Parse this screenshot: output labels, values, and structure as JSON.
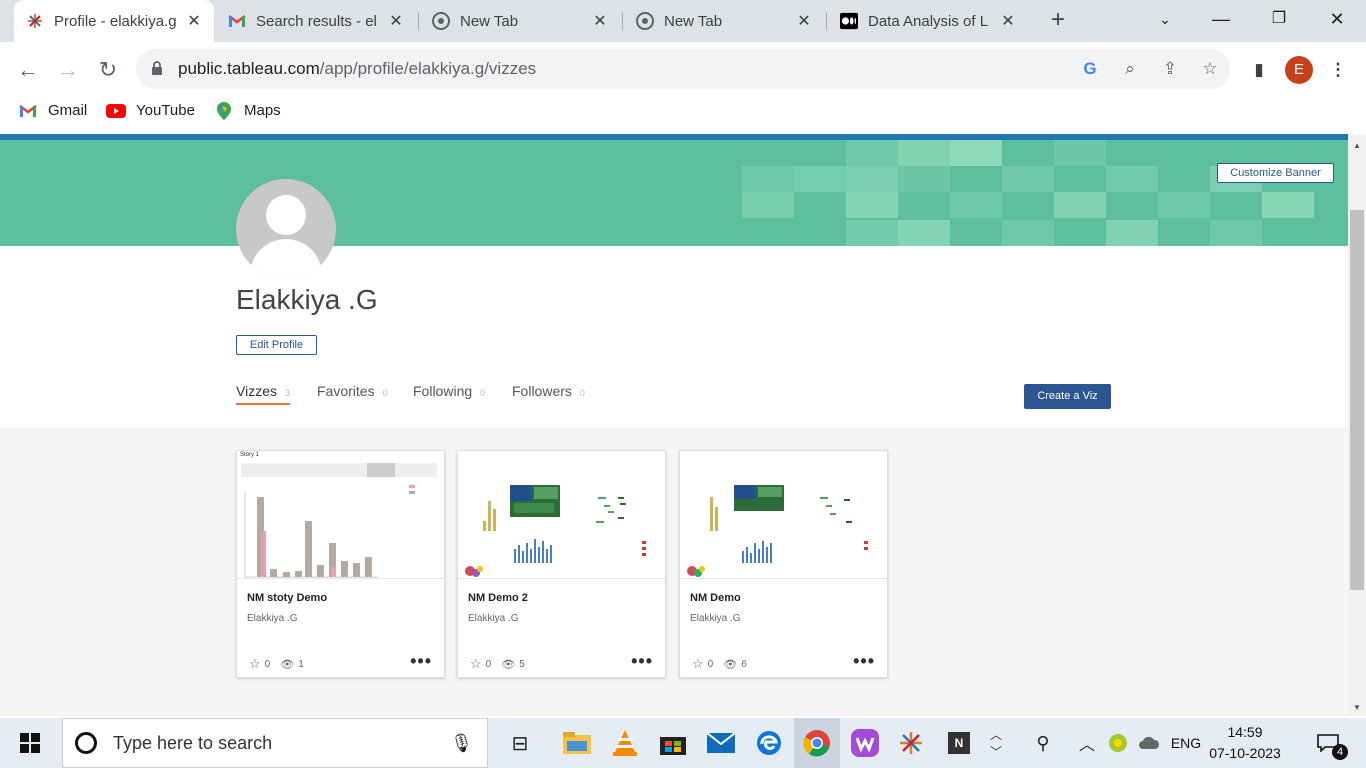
{
  "browser": {
    "tabs": [
      {
        "title": "Profile - elakkiya.g",
        "icon": "tableau-icon",
        "active": true
      },
      {
        "title": "Search results - el",
        "icon": "gmail-icon",
        "active": false
      },
      {
        "title": "New Tab",
        "icon": "chrome-icon",
        "active": false
      },
      {
        "title": "New Tab",
        "icon": "chrome-icon",
        "active": false
      },
      {
        "title": "Data Analysis of L",
        "icon": "medium-icon",
        "active": false
      }
    ],
    "url_domain": "public.tableau.com",
    "url_path": "/app/profile/elakkiya.g/vizzes",
    "profile_initial": "E",
    "bookmarks": [
      {
        "label": "Gmail",
        "icon": "gmail-icon"
      },
      {
        "label": "YouTube",
        "icon": "youtube-icon"
      },
      {
        "label": "Maps",
        "icon": "maps-icon"
      }
    ]
  },
  "profile": {
    "name": "Elakkiya .G",
    "customize_banner_label": "Customize Banner",
    "edit_profile_label": "Edit Profile",
    "create_viz_label": "Create a Viz",
    "tabs": [
      {
        "label": "Vizzes",
        "count": "3",
        "active": true
      },
      {
        "label": "Favorites",
        "count": "0",
        "active": false
      },
      {
        "label": "Following",
        "count": "0",
        "active": false
      },
      {
        "label": "Followers",
        "count": "0",
        "active": false
      }
    ],
    "accent_color": "#2c5592",
    "banner_color": "#5dbf9c"
  },
  "vizzes": [
    {
      "title": "NM stoty Demo",
      "author": "Elakkiya .G",
      "favorites": "0",
      "views": "1",
      "thumb_caption": "Story 1"
    },
    {
      "title": "NM Demo 2",
      "author": "Elakkiya .G",
      "favorites": "0",
      "views": "5"
    },
    {
      "title": "NM Demo",
      "author": "Elakkiya .G",
      "favorites": "0",
      "views": "6"
    }
  ],
  "taskbar": {
    "search_placeholder": "Type here to search",
    "language": "ENG",
    "time": "14:59",
    "date": "07-10-2023",
    "notification_count": "4"
  }
}
